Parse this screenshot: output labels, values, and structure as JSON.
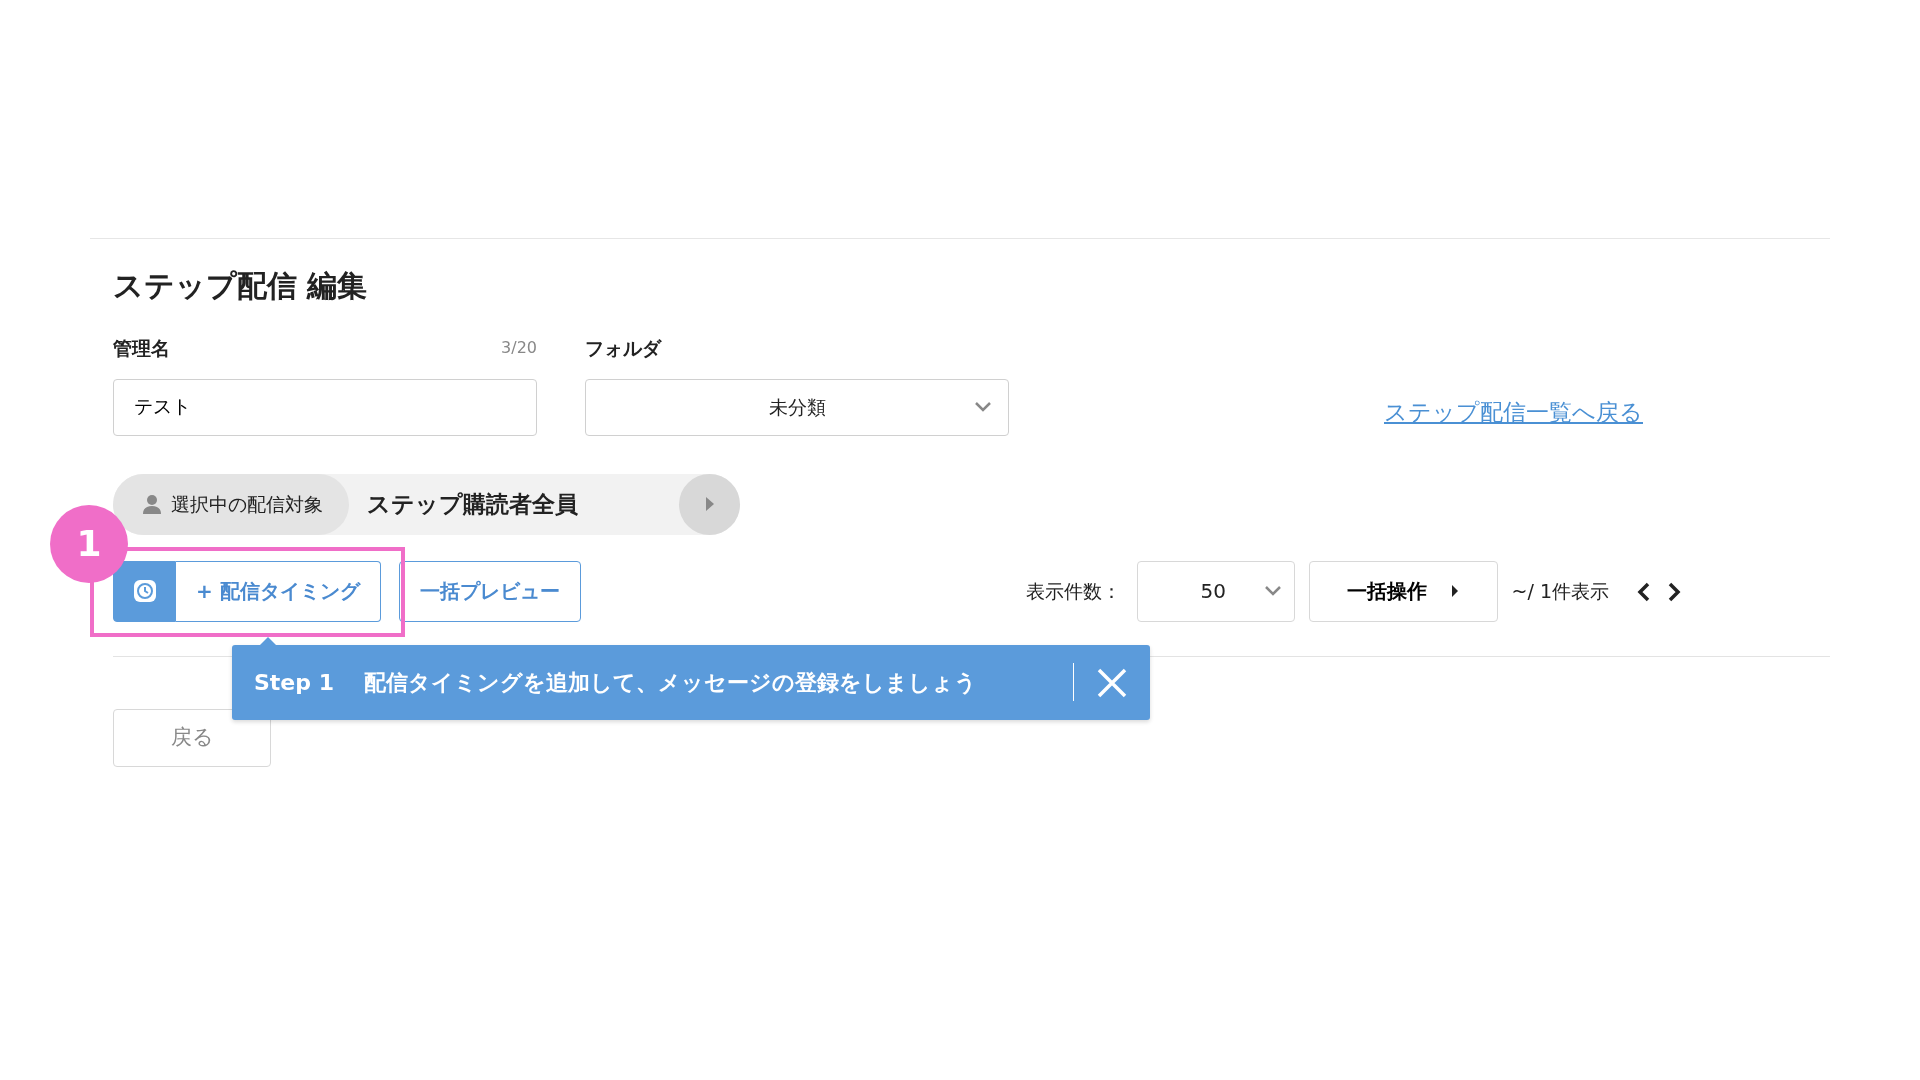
{
  "title": "ステップ配信 編集",
  "fields": {
    "name": {
      "label": "管理名",
      "counter": "3/20",
      "value": "テスト"
    },
    "folder": {
      "label": "フォルダ",
      "value": "未分類"
    }
  },
  "back_link": "ステップ配信一覧へ戻る",
  "target": {
    "label": "選択中の配信対象",
    "value": "ステップ購読者全員"
  },
  "toolbar": {
    "add_button": "+ 配信タイミング",
    "preview_button": "一括プレビュー",
    "per_page_label": "表示件数：",
    "per_page": "50",
    "bulk_button": "一括操作",
    "range": "~/ 1件表示"
  },
  "callout": {
    "number": "1"
  },
  "tooltip": {
    "step": "Step 1",
    "message": "配信タイミングを追加して、メッセージの登録をしましょう"
  },
  "back_button": "戻る"
}
